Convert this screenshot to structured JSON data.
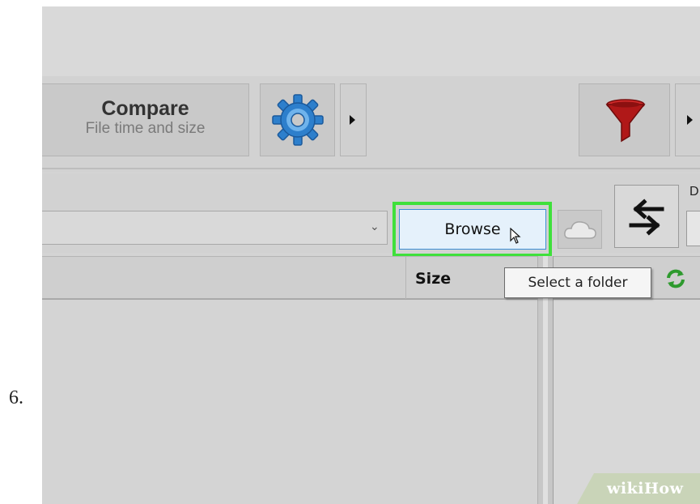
{
  "step_number": "6.",
  "toolbar": {
    "compare_title": "Compare",
    "compare_subtitle": "File time and size",
    "settings_icon": "gear-icon",
    "filter_icon": "funnel-icon"
  },
  "path_row": {
    "browse_label": "Browse",
    "right_label": "D",
    "cloud_icon": "cloud-icon",
    "swap_icon": "swap-arrows-icon"
  },
  "header": {
    "size_label": "Size"
  },
  "tooltip": {
    "text": "Select a folder"
  },
  "watermark": {
    "text": "wikiHow"
  },
  "colors": {
    "highlight": "#3fe03b",
    "browse_bg": "#e5f1fb",
    "browse_border": "#3c8fd6",
    "gear": "#2d7fcc",
    "filter": "#b01818"
  }
}
